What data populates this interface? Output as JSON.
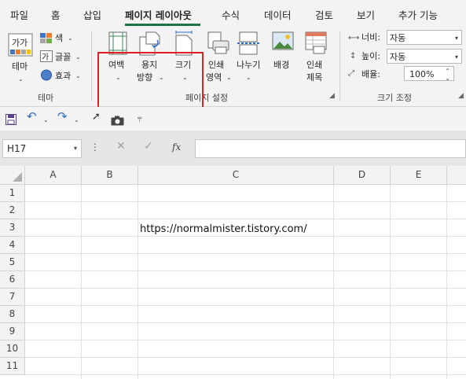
{
  "menu": {
    "tabs": [
      "파일",
      "홈",
      "삽입",
      "페이지 레이아웃",
      "수식",
      "데이터",
      "검토",
      "보기",
      "추가 기능"
    ],
    "active": "페이지 레이아웃"
  },
  "ribbon": {
    "theme_group": {
      "themes_label": "테마",
      "colors_label": "색",
      "fonts_label": "글꼴",
      "effects_label": "효과",
      "group_label": "테마"
    },
    "page_setup": {
      "margins_label": "여백",
      "orientation_label_1": "용지",
      "orientation_label_2": "방향",
      "size_label": "크기",
      "print_area_label_1": "인쇄",
      "print_area_label_2": "영역",
      "breaks_label": "나누기",
      "background_label": "배경",
      "print_titles_label_1": "인쇄",
      "print_titles_label_2": "제목",
      "group_label": "페이지 설정"
    },
    "scale_to_fit": {
      "width_label": "너비:",
      "width_value": "자동",
      "height_label": "높이:",
      "height_value": "자동",
      "scale_label": "배율:",
      "scale_value": "100%",
      "group_label": "크기 조정"
    }
  },
  "formula_bar": {
    "name_box": "H17",
    "fx": "fx",
    "value": ""
  },
  "grid": {
    "columns": [
      "A",
      "B",
      "C",
      "D",
      "E"
    ],
    "rows": [
      "1",
      "2",
      "3",
      "4",
      "5",
      "6",
      "7",
      "8",
      "9",
      "10",
      "11"
    ],
    "cell_C3": "https://normalmister.tistory.com/"
  },
  "colors": {
    "excel_green": "#217346",
    "highlight_red": "#e02020",
    "ribbon_bg": "#f3f3f3"
  }
}
